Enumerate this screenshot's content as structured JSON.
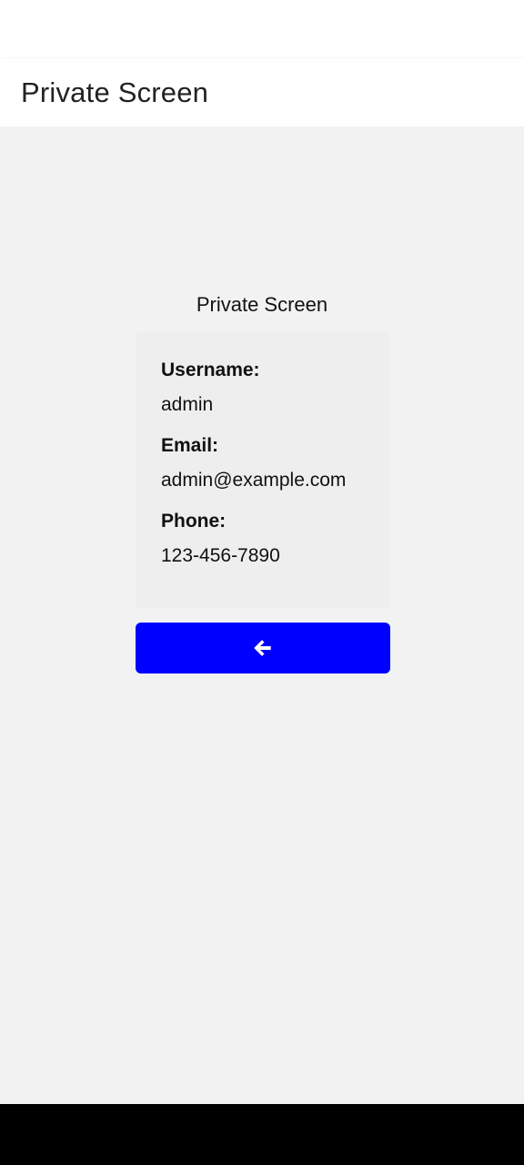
{
  "header": {
    "title": "Private Screen"
  },
  "main": {
    "heading": "Private Screen",
    "card": {
      "username_label": "Username:",
      "username_value": "admin",
      "email_label": "Email:",
      "email_value": "admin@example.com",
      "phone_label": "Phone:",
      "phone_value": "123-456-7890"
    },
    "back_button": {
      "icon": "arrow-left-icon",
      "color": "#0000ff"
    }
  },
  "colors": {
    "background": "#f2f2f2",
    "header_background": "#ffffff",
    "card_background": "#eeeeee",
    "accent": "#0000ff",
    "navigation_bar": "#000000"
  }
}
